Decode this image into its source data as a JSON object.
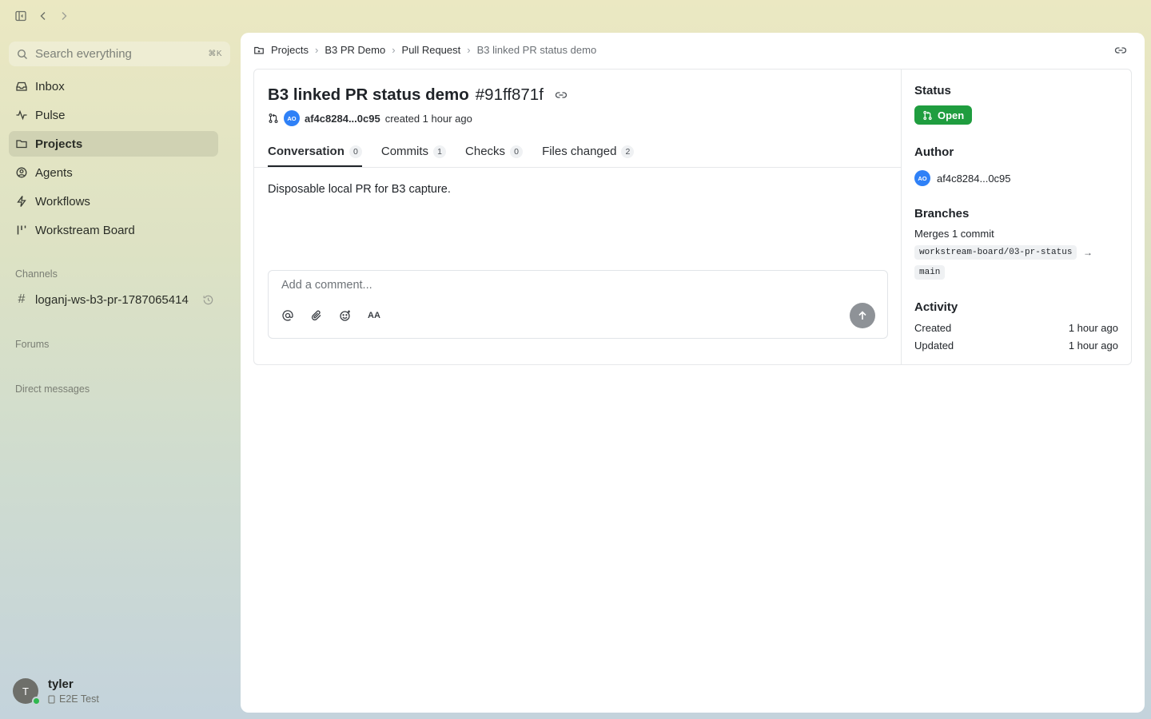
{
  "sidebar": {
    "search_placeholder": "Search everything",
    "search_shortcut": "⌘K",
    "nav": [
      {
        "label": "Inbox"
      },
      {
        "label": "Pulse"
      },
      {
        "label": "Projects"
      },
      {
        "label": "Agents"
      },
      {
        "label": "Workflows"
      },
      {
        "label": "Workstream Board"
      }
    ],
    "channels_label": "Channels",
    "channel_name": "loganj-ws-b3-pr-1787065414",
    "forums_label": "Forums",
    "dms_label": "Direct messages",
    "user": {
      "initial": "T",
      "name": "tyler",
      "status": "E2E Test"
    }
  },
  "breadcrumb": {
    "projects": "Projects",
    "project": "B3 PR Demo",
    "section": "Pull Request",
    "current": "B3 linked PR status demo"
  },
  "pr": {
    "title": "B3 linked PR status demo",
    "hash": "#91ff871f",
    "author_initials": "AO",
    "author": "af4c8284...0c95",
    "created": "created 1 hour ago",
    "tabs": [
      {
        "label": "Conversation",
        "count": "0"
      },
      {
        "label": "Commits",
        "count": "1"
      },
      {
        "label": "Checks",
        "count": "0"
      },
      {
        "label": "Files changed",
        "count": "2"
      }
    ],
    "description": "Disposable local PR for B3 capture.",
    "comment_placeholder": "Add a comment...",
    "text_tool": "AA"
  },
  "details": {
    "status_heading": "Status",
    "status": "Open",
    "author_heading": "Author",
    "author_initials": "AO",
    "author": "af4c8284...0c95",
    "branches_heading": "Branches",
    "merges": "Merges 1 commit",
    "source_branch": "workstream-board/03-pr-status",
    "arrow": "→",
    "target_branch": "main",
    "activity_heading": "Activity",
    "created_label": "Created",
    "created_value": "1 hour ago",
    "updated_label": "Updated",
    "updated_value": "1 hour ago"
  },
  "colors": {
    "accent_open": "#1f9d3f",
    "avatar_blue": "#2f81f7"
  }
}
